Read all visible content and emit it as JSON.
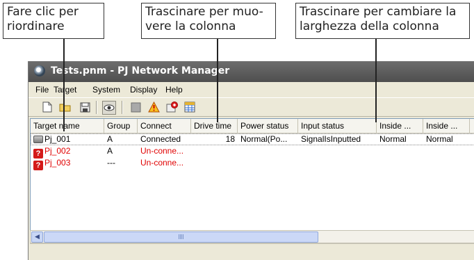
{
  "callouts": {
    "reorder": [
      "Fare clic per",
      "riordinare"
    ],
    "move_column": [
      "Trascinare per muo-",
      "vere la colonna"
    ],
    "resize_column": [
      "Trascinare per cambiare la",
      "larghezza della colonna"
    ]
  },
  "window": {
    "title": "Tests.pnm - PJ Network Manager"
  },
  "menu": [
    "File",
    "Target",
    "System",
    "Display",
    "Help"
  ],
  "toolbar_icons": [
    "new-file-icon",
    "open-folder-icon",
    "save-icon",
    "eye-icon",
    "stop-icon",
    "warning-icon",
    "add-target-icon",
    "grid-icon"
  ],
  "table": {
    "columns": [
      "Target name",
      "Group",
      "Connect",
      "Drive time",
      "Power status",
      "Input status",
      "Inside ...",
      "Inside ..."
    ],
    "rows": [
      {
        "status": "ok",
        "name": "Pj_001",
        "group": "A",
        "connect": "Connected",
        "drive_time": "18",
        "power": "Normal(Po...",
        "input": "SignalIsInputted",
        "inside1": "Normal",
        "inside2": "Normal"
      },
      {
        "status": "error",
        "name": "Pj_002",
        "group": "A",
        "connect": "Un-conne...",
        "drive_time": "",
        "power": "",
        "input": "",
        "inside1": "",
        "inside2": ""
      },
      {
        "status": "error",
        "name": "Pj_003",
        "group": "---",
        "connect": "Un-conne...",
        "drive_time": "",
        "power": "",
        "input": "",
        "inside1": "",
        "inside2": ""
      }
    ]
  },
  "colors": {
    "error_text": "#e00000",
    "titlebar": "#5a5a5a"
  }
}
